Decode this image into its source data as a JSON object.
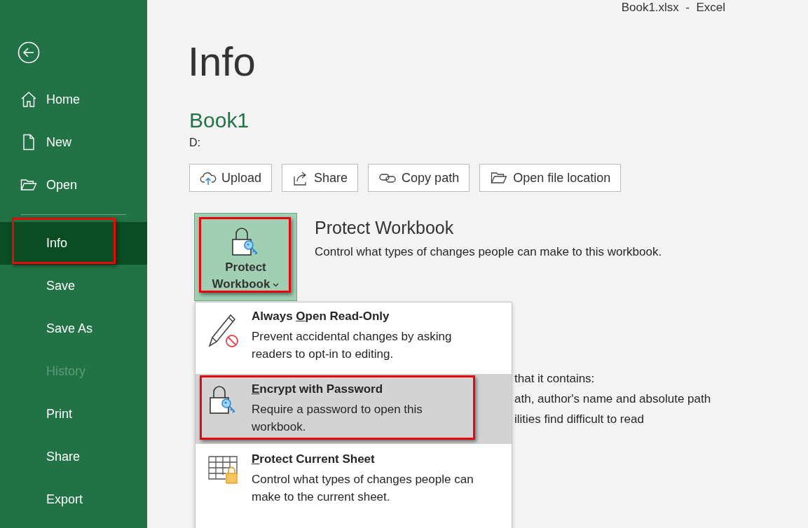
{
  "window": {
    "title": "Book1.xlsx  -  Excel"
  },
  "sidebar": {
    "top_items": [
      {
        "label": "Home",
        "kind": "home",
        "selected": false
      },
      {
        "label": "New",
        "kind": "file",
        "selected": false
      },
      {
        "label": "Open",
        "kind": "folder",
        "selected": false
      }
    ],
    "items": [
      {
        "label": "Info",
        "selected": true,
        "disabled": false,
        "annotated": true
      },
      {
        "label": "Save",
        "selected": false,
        "disabled": false,
        "annotated": false
      },
      {
        "label": "Save As",
        "selected": false,
        "disabled": false,
        "annotated": false
      },
      {
        "label": "History",
        "selected": false,
        "disabled": true,
        "annotated": false
      },
      {
        "label": "Print",
        "selected": false,
        "disabled": false,
        "annotated": false
      },
      {
        "label": "Share",
        "selected": false,
        "disabled": false,
        "annotated": false
      },
      {
        "label": "Export",
        "selected": false,
        "disabled": false,
        "annotated": false
      }
    ]
  },
  "page_title": "Info",
  "document": {
    "name": "Book1",
    "path": "D:"
  },
  "actions": [
    {
      "label": "Upload",
      "kind": "upload"
    },
    {
      "label": "Share",
      "kind": "share"
    },
    {
      "label": "Copy path",
      "kind": "link"
    },
    {
      "label": "Open file location",
      "kind": "folder"
    }
  ],
  "protect": {
    "button_label": "Protect Workbook",
    "expanded": true,
    "annotated": true,
    "title": "Protect Workbook",
    "description": "Control what types of changes people can make to this workbook."
  },
  "menu": {
    "items": [
      {
        "kind": "read-only",
        "title_lead": "Always ",
        "title_key": "O",
        "title_rest": "pen Read-Only",
        "description": "Prevent accidental changes by asking readers to opt-in to editing.",
        "selected": false,
        "annotated": false
      },
      {
        "kind": "encrypt",
        "title_key": "E",
        "title_rest": "ncrypt with Password",
        "description": "Require a password to open this workbook.",
        "selected": true,
        "annotated": true
      },
      {
        "kind": "sheet",
        "title_key": "P",
        "title_rest": "rotect Current Sheet",
        "description": "Control what types of changes people can make to the current sheet.",
        "selected": false,
        "annotated": false
      }
    ]
  },
  "inspect_lines": [
    "that it contains:",
    "ath, author's name and absolute path",
    "ilities find difficult to read"
  ]
}
